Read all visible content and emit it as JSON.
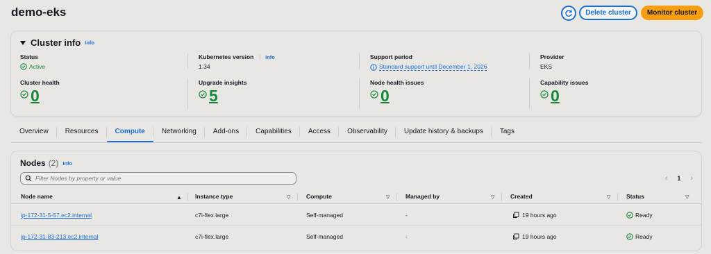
{
  "header": {
    "title": "demo-eks",
    "delete_label": "Delete cluster",
    "monitor_label": "Monitor cluster"
  },
  "cluster_info": {
    "title": "Cluster info",
    "info": "Info",
    "status_label": "Status",
    "status_value": "Active",
    "k8s_label": "Kubernetes version",
    "k8s_info": "Info",
    "k8s_value": "1.34",
    "support_label": "Support period",
    "support_value": "Standard support until December 1, 2026",
    "provider_label": "Provider",
    "provider_value": "EKS",
    "health_label": "Cluster health",
    "health_value": "0",
    "upgrade_label": "Upgrade insights",
    "upgrade_value": "5",
    "node_health_label": "Node health issues",
    "node_health_value": "0",
    "capability_label": "Capability issues",
    "capability_value": "0"
  },
  "tabs": [
    "Overview",
    "Resources",
    "Compute",
    "Networking",
    "Add-ons",
    "Capabilities",
    "Access",
    "Observability",
    "Update history & backups",
    "Tags"
  ],
  "active_tab": "Compute",
  "nodes": {
    "title": "Nodes",
    "count": "(2)",
    "info": "Info",
    "search_placeholder": "Filter Nodes by property or value",
    "page": "1",
    "columns": [
      "Node name",
      "Instance type",
      "Compute",
      "Managed by",
      "Created",
      "Status"
    ],
    "rows": [
      {
        "name": "ip-172-31-5-57.ec2.internal",
        "instance": "c7i-flex.large",
        "compute": "Self-managed",
        "managed": "-",
        "created": "19 hours ago",
        "status": "Ready"
      },
      {
        "name": "ip-172-31-83-213.ec2.internal",
        "instance": "c7i-flex.large",
        "compute": "Self-managed",
        "managed": "-",
        "created": "19 hours ago",
        "status": "Ready"
      }
    ]
  },
  "colors": {
    "accent": "#1c6fd1",
    "success": "#18883a",
    "primary_button": "#f59e14"
  }
}
